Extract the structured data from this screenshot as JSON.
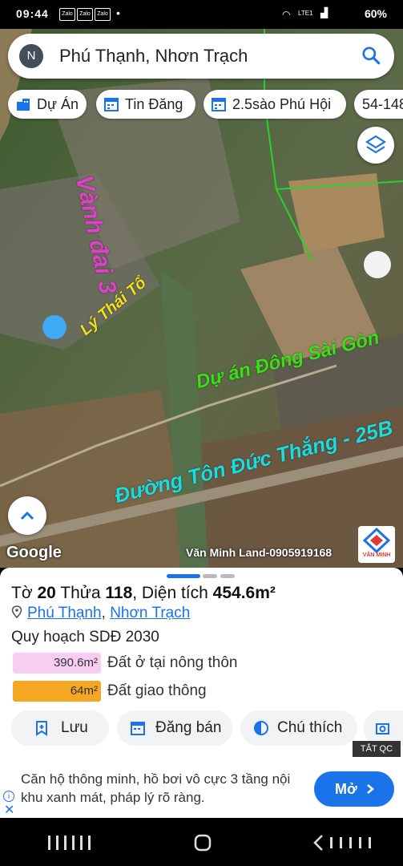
{
  "status_bar": {
    "time": "09:44",
    "apps": [
      "Zalo",
      "Zalo",
      "Zalo"
    ],
    "network": "LTE1",
    "battery": "60%"
  },
  "search": {
    "avatar_initial": "N",
    "query": "Phú Thạnh, Nhơn Trạch"
  },
  "chips": [
    {
      "label": "Dự Án",
      "icon": "building-icon"
    },
    {
      "label": "Tin Đăng",
      "icon": "calendar-icon"
    },
    {
      "label": "2.5sào Phú Hội",
      "icon": "calendar-icon"
    },
    {
      "label": "54-148",
      "icon": ""
    }
  ],
  "map": {
    "labels": {
      "vanh_dai": "Vành đai 3",
      "ly_thai_to": "Lý Thái Tổ",
      "du_an": "Dự án Đông Sài Gòn",
      "ton_duc_thang": "Đường Tôn Đức Thắng - 25B"
    },
    "google_logo": "Google",
    "watermark": "Văn Minh Land-0905919168",
    "brand_badge": "VĂN MINH"
  },
  "parcel": {
    "to_label": "Tờ",
    "to_value": "20",
    "thua_label": "Thửa",
    "thua_value": "118",
    "area_label": ", Diện tích",
    "area_value": "454.6m²",
    "ward": "Phú Thạnh",
    "separator": ", ",
    "district": "Nhơn Trạch",
    "plan_title": "Quy hoạch SDĐ 2030",
    "plan_items": [
      {
        "area": "390.6m²",
        "label": "Đất ở tại nông thôn",
        "color": "#f8cdf2"
      },
      {
        "area": "64m²",
        "label": "Đất giao thông",
        "color": "#f5a623"
      }
    ]
  },
  "actions": [
    {
      "label": "Lưu",
      "icon": "bookmark-plus-icon"
    },
    {
      "label": "Đăng bán",
      "icon": "calendar-icon"
    },
    {
      "label": "Chú thích",
      "icon": "contrast-icon"
    }
  ],
  "ad": {
    "close_label": "TẮT QC",
    "text": "Căn hộ thông minh, hồ bơi vô cực 3 tầng nội khu xanh mát, pháp lý rõ ràng.",
    "button": "Mở"
  },
  "colors": {
    "accent": "#1a73e8",
    "vanh_dai": "#e040c8",
    "ly_thai_to": "#f2e01a",
    "du_an": "#39e01a",
    "ton_duc_thang": "#1adce0"
  }
}
